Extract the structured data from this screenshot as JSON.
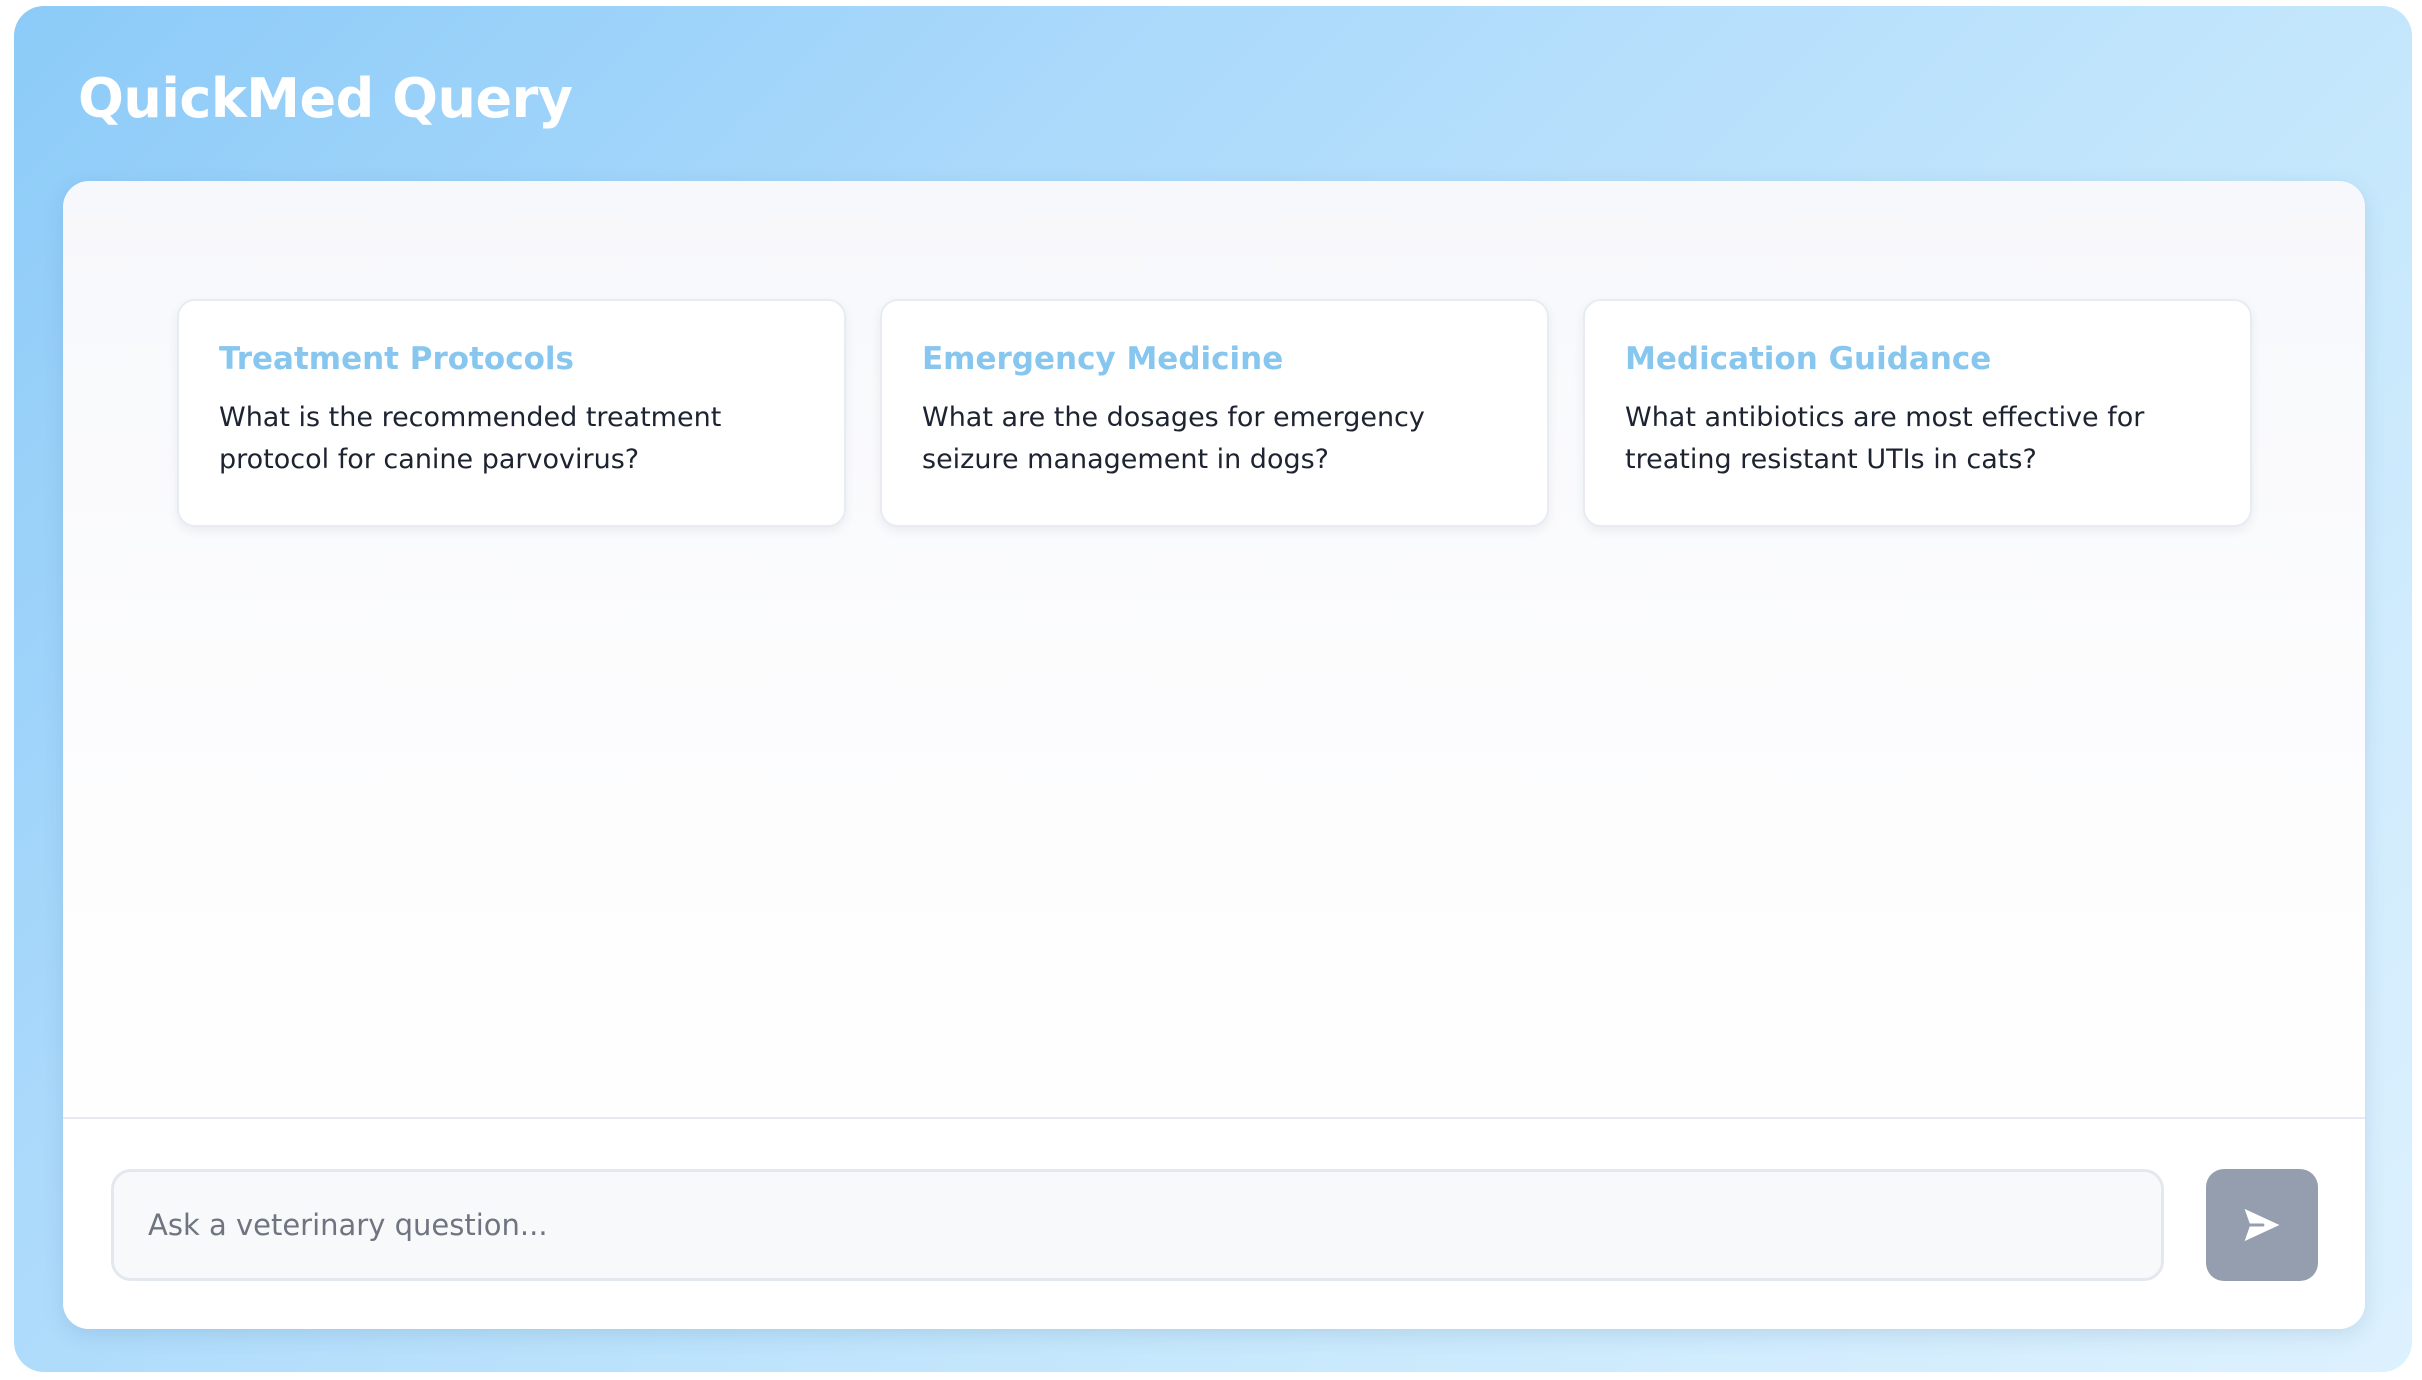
{
  "app": {
    "title": "QuickMed Query"
  },
  "suggestions": [
    {
      "title": "Treatment Protocols",
      "question": "What is the recommended treatment protocol for canine parvovirus?"
    },
    {
      "title": "Emergency Medicine",
      "question": "What are the dosages for emergency seizure management in dogs?"
    },
    {
      "title": "Medication Guidance",
      "question": "What antibiotics are most effective for treating resistant UTIs in cats?"
    }
  ],
  "input": {
    "value": "",
    "placeholder": "Ask a veterinary question..."
  },
  "send_button": {
    "icon": "send-icon"
  },
  "colors": {
    "accent": "#86c6ef",
    "send_button": "#959eae",
    "title_text": "#ffffff"
  }
}
